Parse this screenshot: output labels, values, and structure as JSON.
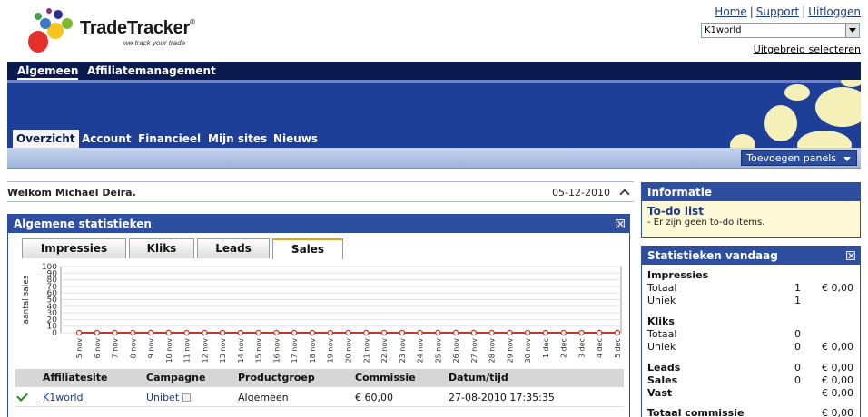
{
  "header": {
    "logo_text": "TradeTracker",
    "logo_registered": "®",
    "tagline": "we track your trade",
    "links": [
      "Home",
      "Support",
      "Uitloggen"
    ],
    "site_select_value": "K1world",
    "advanced_select": "Uitgebreid selecteren"
  },
  "nav": {
    "main": [
      "Algemeen",
      "Affiliatemanagement"
    ],
    "sub": [
      "Overzicht",
      "Account",
      "Financieel",
      "Mijn sites",
      "Nieuws"
    ],
    "add_panels": "Toevoegen panels"
  },
  "welcome": {
    "message": "Welkom Michael Deira.",
    "date": "05-12-2010"
  },
  "stats_panel": {
    "title": "Algemene statistieken",
    "tabs": [
      "Impressies",
      "Kliks",
      "Leads",
      "Sales"
    ],
    "active_tab": "Sales"
  },
  "chart_data": {
    "type": "line",
    "ylabel": "aantal sales",
    "ylim": [
      0,
      100
    ],
    "yticks": [
      0,
      10,
      20,
      30,
      40,
      50,
      60,
      70,
      80,
      90,
      100
    ],
    "categories": [
      "5 nov",
      "6 nov",
      "7 nov",
      "8 nov",
      "9 nov",
      "10 nov",
      "11 nov",
      "12 nov",
      "13 nov",
      "14 nov",
      "15 nov",
      "16 nov",
      "17 nov",
      "18 nov",
      "19 nov",
      "20 nov",
      "21 nov",
      "22 nov",
      "23 nov",
      "24 nov",
      "25 nov",
      "26 nov",
      "27 nov",
      "28 nov",
      "29 nov",
      "30 nov",
      "1 dec",
      "2 dec",
      "3 dec",
      "4 dec",
      "5 dec"
    ],
    "values": [
      0,
      0,
      0,
      0,
      0,
      0,
      0,
      0,
      0,
      0,
      0,
      0,
      0,
      0,
      0,
      0,
      0,
      0,
      0,
      0,
      0,
      0,
      0,
      0,
      0,
      0,
      0,
      0,
      0,
      0,
      0
    ],
    "grid": true,
    "line_color": "#c0392b"
  },
  "table": {
    "headers": [
      "Affiliatesite",
      "Campagne",
      "Productgroep",
      "Commissie",
      "Datum/tijd"
    ],
    "rows": [
      {
        "site": "K1world",
        "campaign": "Unibet",
        "productgroup": "Algemeen",
        "commission": "€ 60,00",
        "datetime": "27-08-2010 17:35:35"
      }
    ]
  },
  "info_panel": {
    "title": "Informatie",
    "todo_title": "To-do list",
    "todo_text": "- Er zijn geen to-do items."
  },
  "today_panel": {
    "title": "Statistieken vandaag",
    "impressies": {
      "label": "Impressies",
      "totaal_label": "Totaal",
      "totaal_num": "1",
      "totaal_amt": "€ 0,00",
      "uniek_label": "Uniek",
      "uniek_num": "1"
    },
    "kliks": {
      "label": "Kliks",
      "totaal_label": "Totaal",
      "totaal_num": "0",
      "uniek_label": "Uniek",
      "uniek_num": "0",
      "uniek_amt": "€ 0,00"
    },
    "leads": {
      "label": "Leads",
      "num": "0",
      "amt": "€ 0,00"
    },
    "sales": {
      "label": "Sales",
      "num": "0",
      "amt": "€ 0,00"
    },
    "vast": {
      "label": "Vast",
      "amt": "€ 0,00"
    },
    "totaal_commissie": {
      "label": "Totaal commissie",
      "amt": "€ 0,00"
    }
  },
  "colors": {
    "nav_dark": "#0b1a4e",
    "banner_blue": "#1d3f98",
    "panel_blue": "#2e4f9f",
    "active_tab_accent": "#e9a21c",
    "info_bg": "#fdf8d6"
  }
}
